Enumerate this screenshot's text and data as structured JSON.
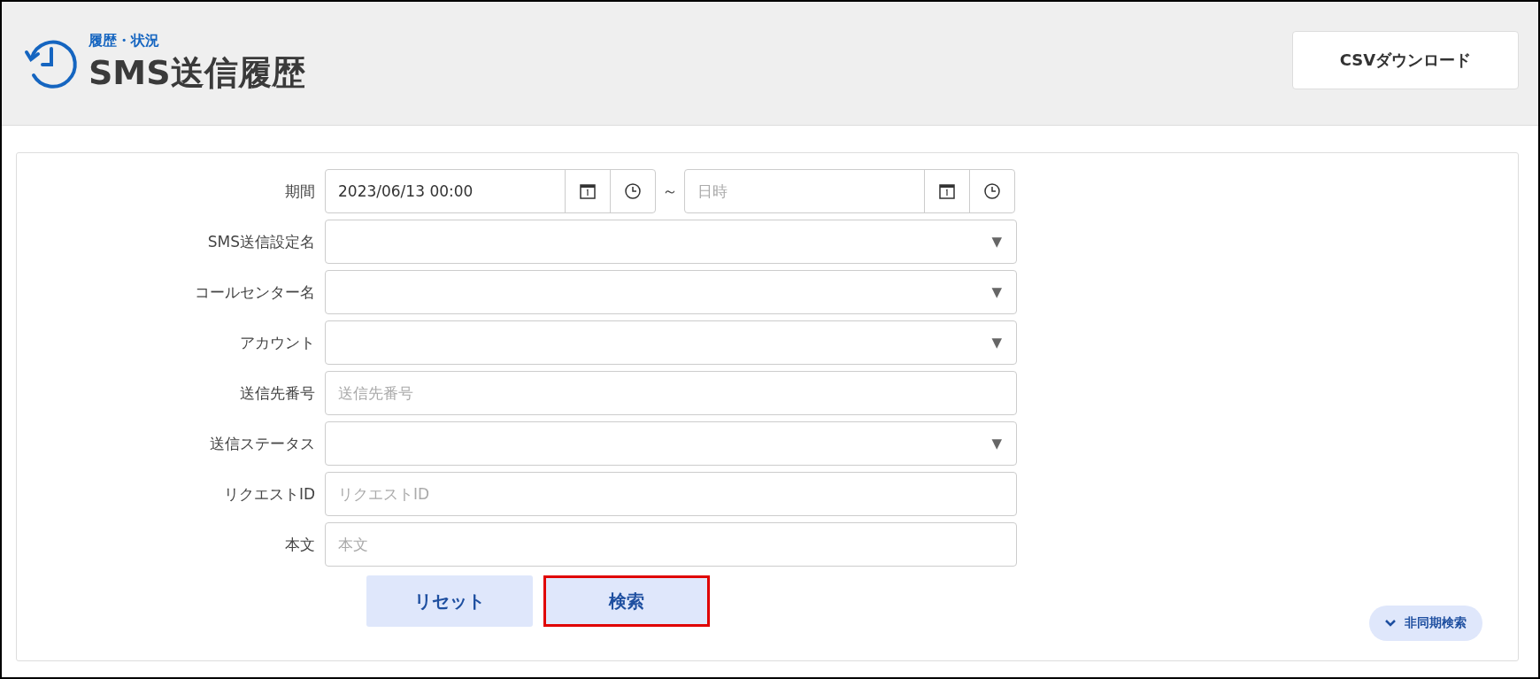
{
  "header": {
    "breadcrumb": "履歴・状況",
    "title": "SMS送信履歴",
    "csv_button": "CSVダウンロード"
  },
  "form": {
    "fields": [
      {
        "kind": "daterange",
        "label": "期間",
        "from_value": "2023/06/13 00:00",
        "separator": "～",
        "to_placeholder": "日時"
      },
      {
        "kind": "select",
        "label": "SMS送信設定名",
        "arrow": "▼"
      },
      {
        "kind": "select",
        "label": "コールセンター名",
        "arrow": "▼"
      },
      {
        "kind": "select",
        "label": "アカウント",
        "arrow": "▼"
      },
      {
        "kind": "text",
        "label": "送信先番号",
        "placeholder": "送信先番号"
      },
      {
        "kind": "select",
        "label": "送信ステータス",
        "arrow": "▼"
      },
      {
        "kind": "text",
        "label": "リクエストID",
        "placeholder": "リクエストID"
      },
      {
        "kind": "text",
        "label": "本文",
        "placeholder": "本文"
      }
    ],
    "buttons": [
      {
        "label": "リセット",
        "highlighted": false
      },
      {
        "label": "検索",
        "highlighted": true
      }
    ],
    "async_toggle": {
      "label": "非同期検索",
      "expanded": false
    }
  }
}
